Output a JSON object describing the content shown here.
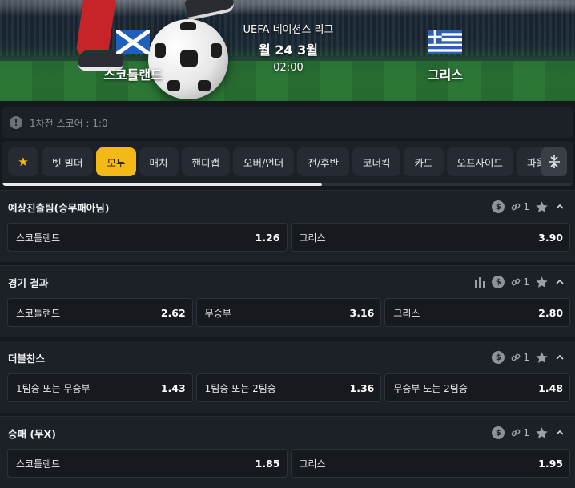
{
  "match": {
    "league": "UEFA 네이션스 리그",
    "date": "월 24 3월",
    "time": "02:00",
    "home": "스코틀랜드",
    "away": "그리스"
  },
  "first_leg": {
    "icon": "alert-icon",
    "text": "1차전 스코어 : 1:0"
  },
  "tabs": [
    {
      "label": "★",
      "icon": "star-icon"
    },
    {
      "label": "벳 빌더"
    },
    {
      "label": "모두",
      "active": true
    },
    {
      "label": "매치"
    },
    {
      "label": "핸디캡"
    },
    {
      "label": "오버/언더"
    },
    {
      "label": "전/후반"
    },
    {
      "label": "코너킥"
    },
    {
      "label": "카드"
    },
    {
      "label": "오프사이드"
    },
    {
      "label": "파울"
    }
  ],
  "tabs_scroll_progress": 0.56,
  "markets": [
    {
      "title": "예상진출팀(승무패아님)",
      "link_count": "1",
      "odds": [
        {
          "label": "스코틀랜드",
          "value": "1.26"
        },
        {
          "label": "그리스",
          "value": "3.90"
        }
      ]
    },
    {
      "title": "경기 결과",
      "link_count": "1",
      "odds": [
        {
          "label": "스코틀랜드",
          "value": "2.62"
        },
        {
          "label": "무승부",
          "value": "3.16"
        },
        {
          "label": "그리스",
          "value": "2.80"
        }
      ]
    },
    {
      "title": "더블찬스",
      "link_count": "1",
      "odds": [
        {
          "label": "1팀승 또는 무승부",
          "value": "1.43"
        },
        {
          "label": "1팀승 또는 2팀승",
          "value": "1.36"
        },
        {
          "label": "무승부 또는 2팀승",
          "value": "1.48"
        }
      ]
    },
    {
      "title": "승패 (무X)",
      "link_count": "1",
      "odds": [
        {
          "label": "스코틀랜드",
          "value": "1.85"
        },
        {
          "label": "그리스",
          "value": "1.95"
        }
      ]
    }
  ],
  "colors": {
    "accent": "#f5b915",
    "panel": "#1c2027",
    "background": "#15181d"
  }
}
